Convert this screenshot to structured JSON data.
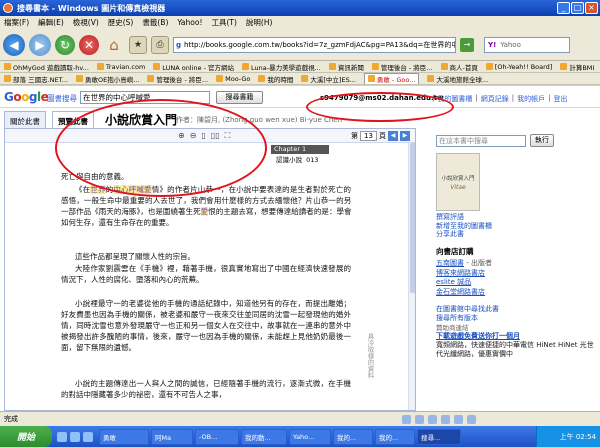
{
  "window": {
    "title": "搜尋書本 - Windows 圖片和傳真檢視器",
    "title_fragment": " - Google 圖書搜尋 - Mozilla Firefox"
  },
  "menu": [
    "檔案(F)",
    "編輯(E)",
    "檢視(V)",
    "歷史(S)",
    "書籤(B)",
    "Yahoo!",
    "工具(T)",
    "說明(H)"
  ],
  "nav": {
    "url": "http://books.google.com.tw/books?id=7z_gzmFdjAC&pg=PA13&dq=在世界的中心呼喊愛&hl=zh-TW&sig=...",
    "yahoo_label": "Y!",
    "yahoo_placeholder": "Yahoo"
  },
  "bookmarks_1": [
    "OhMyGod 遊戲讀取-hv...",
    "Travian.com",
    "LUNA online - 官方網站",
    "Luna-暴力美學遊戲視...",
    "資訊新聞",
    "管理後台 - 將臣...",
    "商人-首頁",
    "[Oh-Yeah!! Board]",
    "計算BMI"
  ],
  "bookmarks_2": [
    "部落 三國志.NET...",
    "勇敢OE抱小島嶼...",
    "管理後台 - 將臣...",
    "Moo-Go",
    "我的時間",
    "大溪[中立]ES...",
    "勇敢 - Goo...",
    "大溪地旅館全球..."
  ],
  "google": {
    "logo": "Google",
    "sub": "圖書搜尋",
    "query": "在世界的中心呼喊愛",
    "search_button": "搜尋書籍",
    "user_email": "s9479079@ms02.dahan.edu.tw",
    "links": [
      "我的圖書櫃",
      "網頁記錄",
      "我的帳戶",
      "登出"
    ]
  },
  "book": {
    "tab_about": "關於此書",
    "tab_preview": "預覽此書",
    "title": "小說欣賞入門",
    "author": "作者：陳碧月, (Zhong guo wen xue) Bi-yue Chen",
    "page_label": "第",
    "page_number": "13",
    "page_unit": "頁",
    "pages_total": "共",
    "chapter": "Chapter 1",
    "chapter_sub": "認識小說",
    "page_no": "013",
    "paragraphs": [
      "死亡與自由的意義。",
      "《在世界的中心呼喊愛情》的作者片山恭一，在小說中要表達的是生者對於死亡的感悟，一般生命中最重要的人去世了，我們會用什麼樣的方式去緬懷他？片山恭一的另一部作品《雨天的海豚》，也是圍繞著生死愛恨的主題去寫，想要傳達給讀者的是：學會如何生存，還有生命存在的重要。",
      "這些作品都呈現了關懷人性的宗旨。",
      "大陸作家劉震雲在《手機》裡，藉著手機，很真實地寫出了中國在經濟快速發展的情況下，人性的腐化、墮落和內心的荒蕪。",
      "小說裡最守一的老婆從他的手機的通話紀錄中，知道他另有的存在，而提出離婚；好友費墨也因為手機的關係，被老婆和嚴守一夜來交往並同居的沈雪一起發現他的婚外情，同時沈雪也意外發現嚴守一也正和另一個女人在交往中，故事就在一連串的意外中被揭發出許多醜陋的事情，後來，嚴守一也因為手機的關係，未能趕上見他奶奶最後一面，留下無限的遺憾。",
      "小說的主題傳達出一人與人之間的誠信，已經隨著手機的流行，逐漸式微，在手機的對話中隱藏著多少的祕密，還有不可告人之事，"
    ],
    "side_note": "具冷取樣的資料"
  },
  "sidebar": {
    "search_placeholder": "在這本書中搜尋",
    "search_button": "執行",
    "cover_title": "小說欣賞入門",
    "cover_caption": "Vitae",
    "links_1": [
      "撰寫評語",
      "新增至我的圖書櫃",
      "分享此書"
    ],
    "store_heading": "向書店訂購",
    "stores": [
      {
        "name": "五南圖書",
        "desc": "- 出版者"
      },
      {
        "name": "博客來網路書店",
        "desc": ""
      },
      {
        "name": "eslite 誠品",
        "desc": ""
      },
      {
        "name": "金石堂網路書店",
        "desc": ""
      }
    ],
    "links_2": [
      "在圖書館中尋找此書",
      "搜尋所有版本"
    ],
    "ad_label": "贊助商連結",
    "ad_title": "下載遊戲免費送你打一個月",
    "ad_desc": "寬頻網路，快速便捷的中華電信 HiNet HiNet 光世代光纖網路，優惠實價中"
  },
  "status": {
    "text": "完成"
  },
  "taskbar": {
    "start": "開始",
    "tasks": [
      "勇敢",
      "阿Ma",
      "-OB...",
      "我的動...",
      "Yaho...",
      "我的...",
      "我的...",
      "搜尋..."
    ],
    "clock": "上午 02:54"
  }
}
